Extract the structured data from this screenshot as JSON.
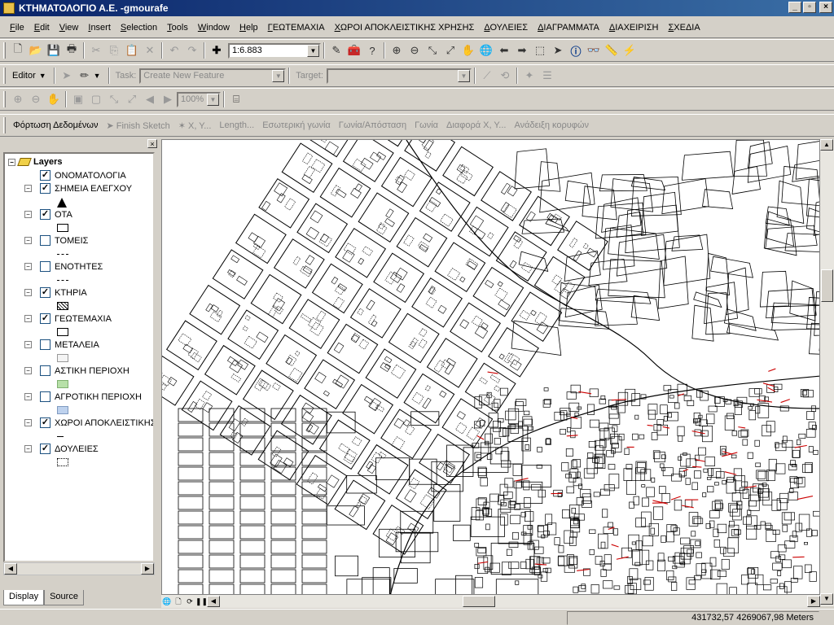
{
  "window": {
    "title": "ΚΤΗΜΑΤΟΛΟΓΙΟ Α.Ε. -gmourafe"
  },
  "menu": [
    "File",
    "Edit",
    "View",
    "Insert",
    "Selection",
    "Tools",
    "Window",
    "Help",
    "ΓΕΩΤΕΜΑΧΙΑ",
    "ΧΩΡΟΙ ΑΠΟΚΛΕΙΣΤΙΚΗΣ ΧΡΗΣΗΣ",
    "ΔΟΥΛΕΙΕΣ",
    "ΔΙΑΓΡΑΜΜΑΤΑ",
    "ΔΙΑΧΕΙΡΙΣΗ",
    "ΣΧΕΔΙΑ"
  ],
  "standard_toolbar": {
    "scale": "1:6.883"
  },
  "editor_toolbar": {
    "editor_label": "Editor",
    "task_label": "Task:",
    "task_value": "Create New Feature",
    "target_label": "Target:"
  },
  "layout_toolbar": {
    "zoom": "100%"
  },
  "custom_toolbar": {
    "items": [
      "Φόρτωση Δεδομένων",
      "Finish Sketch",
      "X, Y...",
      "Length...",
      "Εσωτερική γωνία",
      "Γωνία/Απόσταση",
      "Γωνία",
      "Διαφορά X, Y...",
      "Ανάδειξη κορυφών"
    ]
  },
  "toc": {
    "root_label": "Layers",
    "layers": [
      {
        "name": "ΟΝΟΜΑΤΟΛΟΓΙΑ",
        "checked": true,
        "expandable": false
      },
      {
        "name": "ΣΗΜΕΙΑ ΕΛΕΓΧΟΥ",
        "checked": true,
        "expandable": true,
        "symbol": "triangle"
      },
      {
        "name": "ΟΤΑ",
        "checked": true,
        "expandable": true,
        "symbol": "outline"
      },
      {
        "name": "ΤΟΜΕΙΣ",
        "checked": false,
        "expandable": true,
        "symbol": "dashed"
      },
      {
        "name": "ΕΝΟΤΗΤΕΣ",
        "checked": false,
        "expandable": true,
        "symbol": "dashed"
      },
      {
        "name": "ΚΤΗΡΙΑ",
        "checked": true,
        "expandable": true,
        "symbol": "hatched"
      },
      {
        "name": "ΓΕΩΤΕΜΑΧΙΑ",
        "checked": true,
        "expandable": true,
        "symbol": "outline"
      },
      {
        "name": "ΜΕΤΑΛΕΙΑ",
        "checked": false,
        "expandable": true,
        "symbol": "light"
      },
      {
        "name": "ΑΣΤΙΚΗ ΠΕΡΙΟΧΗ",
        "checked": false,
        "expandable": true,
        "symbol": "green"
      },
      {
        "name": "ΑΓΡΟΤΙΚΗ ΠΕΡΙΟΧΗ",
        "checked": false,
        "expandable": true,
        "symbol": "blue"
      },
      {
        "name": "ΧΩΡΟΙ ΑΠΟΚΛΕΙΣΤΙΚΗΣ Χ",
        "checked": true,
        "expandable": true,
        "symbol": "line"
      },
      {
        "name": "ΔΟΥΛΕΙΕΣ",
        "checked": true,
        "expandable": true,
        "symbol": "dotted"
      }
    ],
    "tabs": [
      "Display",
      "Source"
    ]
  },
  "status": {
    "coordinates": "431732,57  4269067,98 Meters"
  },
  "colors": {
    "titlebar": "#0a246a",
    "map_lines": "#000000",
    "map_highlight": "#cc0000",
    "legend_green": "#b7e0a8",
    "legend_blue": "#bed2ee"
  }
}
